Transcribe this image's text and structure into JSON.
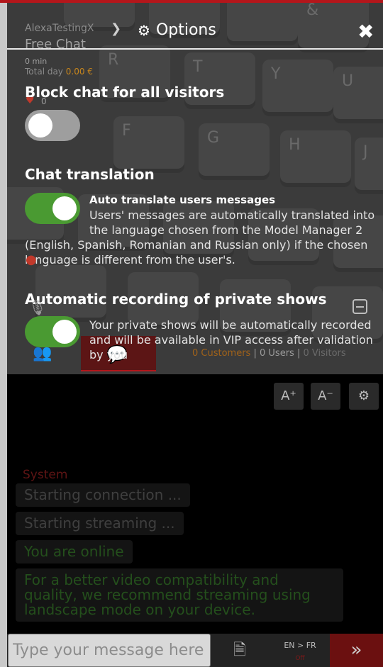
{
  "header": {
    "username": "AlexaTestingX",
    "title": "Options",
    "chat_type": "Free Chat",
    "time": "0 min",
    "total_label": "Total day",
    "total_amount": "0.00 €"
  },
  "stats": {
    "hearts": "0"
  },
  "sections": {
    "block_chat": {
      "title": "Block chat for all visitors",
      "enabled": false
    },
    "translation": {
      "title": "Chat translation",
      "enabled": true,
      "option_title": "Auto translate users messages",
      "desc_line1": "Users' messages are automatically translated into",
      "desc_line2": "the language chosen from the Model Manager 2",
      "desc_line3": "(English, Spanish, Romanian and Russian only) if the chosen",
      "desc_line4": "language is different from the user's."
    },
    "recording": {
      "title": "Automatic recording of private shows",
      "enabled": true,
      "desc_line1": "Your private shows will be automatically recorded",
      "desc_line2": "and will be available in VIP access after validation",
      "desc_line3": "by you"
    }
  },
  "counts": {
    "customers": "0 Customers",
    "users": "0 Users",
    "visitors": "0 Visitors",
    "sep": "|"
  },
  "toolbar": {
    "font_up": "A⁺",
    "font_down": "A⁻"
  },
  "chat": {
    "system_label": "System",
    "messages": [
      "Starting connection ...",
      "Starting streaming ...",
      "You are online",
      "For a better video compatibility and quality, we recommend streaming using landscape mode on your device."
    ],
    "input_placeholder": "Type your message here",
    "lang_pair": "EN > FR",
    "lang_state": "Off"
  },
  "colors": {
    "toggle_on": "#4a9a32",
    "toggle_off": "#9e9e9e",
    "accent": "#b4161b"
  }
}
